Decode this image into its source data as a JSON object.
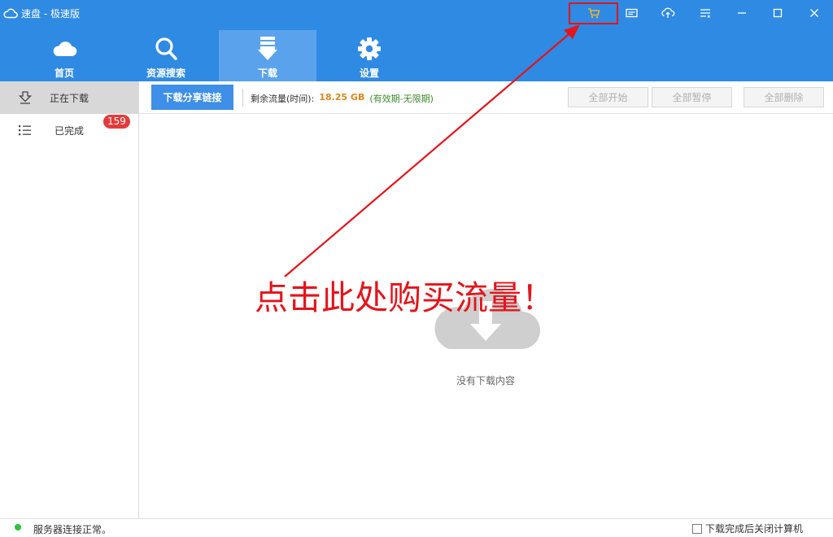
{
  "app": {
    "title": "速盘 - 极速版"
  },
  "titlebar_icons": [
    "cart-icon",
    "message-icon",
    "cloud-upload-icon",
    "menu-icon",
    "minimize-icon",
    "maximize-icon",
    "close-icon"
  ],
  "nav": {
    "tabs": [
      {
        "label": "首页",
        "icon": "cloud-icon"
      },
      {
        "label": "资源搜索",
        "icon": "search-icon"
      },
      {
        "label": "下载",
        "icon": "download-icon",
        "active": true
      },
      {
        "label": "设置",
        "icon": "gear-icon"
      }
    ]
  },
  "sidebar": {
    "items": [
      {
        "label": "正在下载",
        "icon": "downloading-icon",
        "active": true
      },
      {
        "label": "已完成",
        "icon": "list-icon",
        "badge": "159"
      }
    ]
  },
  "toolbar": {
    "share_label": "下载分享链接",
    "quota_label": "剩余流量(时间):",
    "quota_value": "18.25 GB",
    "quota_validity": "(有效期-无限期)",
    "start_all": "全部开始",
    "pause_all": "全部暂停",
    "delete_all": "全部删除"
  },
  "main": {
    "empty_text": "没有下载内容"
  },
  "annotation": {
    "text": "点击此处购买流量！"
  },
  "statusbar": {
    "status_text": "服务器连接正常。",
    "shutdown_label": "下载完成后关闭计算机",
    "shutdown_checked": false
  },
  "colors": {
    "header": "#2f8ae3",
    "active_tab": "#5aa3ec",
    "accent_button": "#3d8fe8",
    "quota_value": "#e0861a",
    "quota_validity": "#3a8a2a",
    "badge": "#e53a3a",
    "annotation": "#e4141b",
    "status_ok": "#2ec33e"
  }
}
